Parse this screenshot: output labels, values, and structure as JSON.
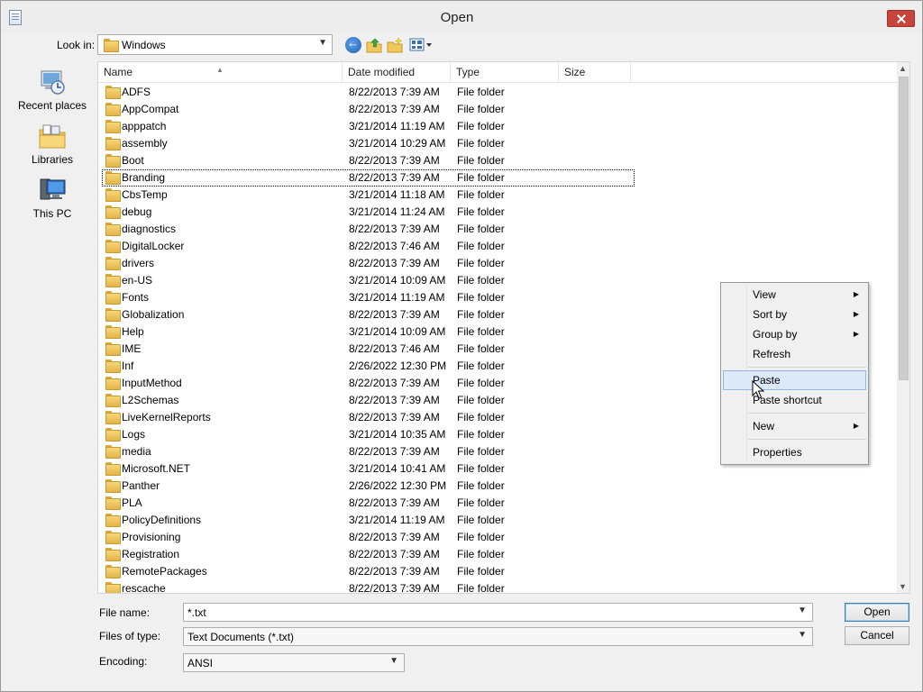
{
  "window": {
    "title": "Open"
  },
  "toolbar": {
    "lookin_label": "Look in:",
    "lookin_value": "Windows"
  },
  "places": [
    {
      "label": "Recent places",
      "icon": "recent-places-icon"
    },
    {
      "label": "Libraries",
      "icon": "libraries-icon"
    },
    {
      "label": "This PC",
      "icon": "this-pc-icon"
    }
  ],
  "columns": {
    "name": "Name",
    "date": "Date modified",
    "type": "Type",
    "size": "Size"
  },
  "files": [
    {
      "name": "ADFS",
      "date": "8/22/2013 7:39 AM",
      "type": "File folder"
    },
    {
      "name": "AppCompat",
      "date": "8/22/2013 7:39 AM",
      "type": "File folder"
    },
    {
      "name": "apppatch",
      "date": "3/21/2014 11:19 AM",
      "type": "File folder"
    },
    {
      "name": "assembly",
      "date": "3/21/2014 10:29 AM",
      "type": "File folder"
    },
    {
      "name": "Boot",
      "date": "8/22/2013 7:39 AM",
      "type": "File folder"
    },
    {
      "name": "Branding",
      "date": "8/22/2013 7:39 AM",
      "type": "File folder"
    },
    {
      "name": "CbsTemp",
      "date": "3/21/2014 11:18 AM",
      "type": "File folder"
    },
    {
      "name": "debug",
      "date": "3/21/2014 11:24 AM",
      "type": "File folder"
    },
    {
      "name": "diagnostics",
      "date": "8/22/2013 7:39 AM",
      "type": "File folder"
    },
    {
      "name": "DigitalLocker",
      "date": "8/22/2013 7:46 AM",
      "type": "File folder"
    },
    {
      "name": "drivers",
      "date": "8/22/2013 7:39 AM",
      "type": "File folder"
    },
    {
      "name": "en-US",
      "date": "3/21/2014 10:09 AM",
      "type": "File folder"
    },
    {
      "name": "Fonts",
      "date": "3/21/2014 11:19 AM",
      "type": "File folder"
    },
    {
      "name": "Globalization",
      "date": "8/22/2013 7:39 AM",
      "type": "File folder"
    },
    {
      "name": "Help",
      "date": "3/21/2014 10:09 AM",
      "type": "File folder"
    },
    {
      "name": "IME",
      "date": "8/22/2013 7:46 AM",
      "type": "File folder"
    },
    {
      "name": "Inf",
      "date": "2/26/2022 12:30 PM",
      "type": "File folder"
    },
    {
      "name": "InputMethod",
      "date": "8/22/2013 7:39 AM",
      "type": "File folder"
    },
    {
      "name": "L2Schemas",
      "date": "8/22/2013 7:39 AM",
      "type": "File folder"
    },
    {
      "name": "LiveKernelReports",
      "date": "8/22/2013 7:39 AM",
      "type": "File folder"
    },
    {
      "name": "Logs",
      "date": "3/21/2014 10:35 AM",
      "type": "File folder"
    },
    {
      "name": "media",
      "date": "8/22/2013 7:39 AM",
      "type": "File folder"
    },
    {
      "name": "Microsoft.NET",
      "date": "3/21/2014 10:41 AM",
      "type": "File folder"
    },
    {
      "name": "Panther",
      "date": "2/26/2022 12:30 PM",
      "type": "File folder"
    },
    {
      "name": "PLA",
      "date": "8/22/2013 7:39 AM",
      "type": "File folder"
    },
    {
      "name": "PolicyDefinitions",
      "date": "3/21/2014 11:19 AM",
      "type": "File folder"
    },
    {
      "name": "Provisioning",
      "date": "8/22/2013 7:39 AM",
      "type": "File folder"
    },
    {
      "name": "Registration",
      "date": "8/22/2013 7:39 AM",
      "type": "File folder"
    },
    {
      "name": "RemotePackages",
      "date": "8/22/2013 7:39 AM",
      "type": "File folder"
    },
    {
      "name": "rescache",
      "date": "8/22/2013 7:39 AM",
      "type": "File folder"
    }
  ],
  "focused_file": "Branding",
  "bottom": {
    "filename_label": "File name:",
    "filename_value": "*.txt",
    "filetype_label": "Files of type:",
    "filetype_value": "Text Documents (*.txt)",
    "encoding_label": "Encoding:",
    "encoding_value": "ANSI",
    "open_label": "Open",
    "cancel_label": "Cancel"
  },
  "context_menu": {
    "items": [
      {
        "label": "View",
        "submenu": true
      },
      {
        "label": "Sort by",
        "submenu": true
      },
      {
        "label": "Group by",
        "submenu": true
      },
      {
        "label": "Refresh",
        "submenu": false
      },
      {
        "label": "Paste",
        "submenu": false,
        "highlighted": true
      },
      {
        "label": "Paste shortcut",
        "submenu": false
      },
      {
        "label": "New",
        "submenu": true
      },
      {
        "label": "Properties",
        "submenu": false
      }
    ]
  },
  "colors": {
    "highlight_bg": "#dbe9f8",
    "highlight_border": "#8fb8e6",
    "close_button": "#c7443b",
    "folder": "#f7d77a"
  }
}
